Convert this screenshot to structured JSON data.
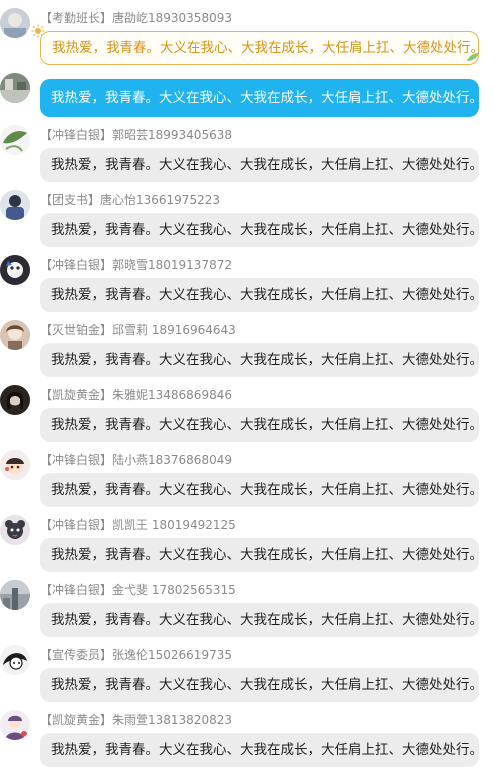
{
  "chat": {
    "messages": [
      {
        "sender": "【考勤班长】唐劭屹18930358093",
        "text": "我热爱，我青春。大义在我心、大我在成长，大任肩上扛、大德处处行。",
        "style": "gold",
        "avatar_color": "#c9cfd8"
      },
      {
        "sender": "",
        "text": "我热爱，我青春。大义在我心、大我在成长，大任肩上扛、大德处处行。",
        "style": "blue",
        "avatar_color": "#7d8a7c"
      },
      {
        "sender": "【冲锋白银】郭昭芸18993405638",
        "text": "我热爱，我青春。大义在我心、大我在成长，大任肩上扛、大德处处行。",
        "style": "gray",
        "avatar_color": "#5f8a4a"
      },
      {
        "sender": "【团支书】唐心怡13661975223",
        "text": "我热爱，我青春。大义在我心、大我在成长，大任肩上扛、大德处处行。",
        "style": "gray",
        "avatar_color": "#445a8c"
      },
      {
        "sender": "【冲锋白银】郭晓雪18019137872",
        "text": "我热爱，我青春。大义在我心、大我在成长，大任肩上扛、大德处处行。",
        "style": "gray",
        "avatar_color": "#2b2b33"
      },
      {
        "sender": "【灭世铂金】邱雪莉 18916964643",
        "text": "我热爱，我青春。大义在我心、大我在成长，大任肩上扛、大德处处行。",
        "style": "gray",
        "avatar_color": "#d9c4b4"
      },
      {
        "sender": "【凯旋黄金】朱雅妮13486869846",
        "text": "我热爱，我青春。大义在我心、大我在成长，大任肩上扛、大德处处行。",
        "style": "gray",
        "avatar_color": "#2a2320"
      },
      {
        "sender": "【冲锋白银】陆小燕18376868049",
        "text": "我热爱，我青春。大义在我心、大我在成长，大任肩上扛、大德处处行。",
        "style": "gray",
        "avatar_color": "#f3ecec"
      },
      {
        "sender": "【冲锋白银】凯凯王 18019492125",
        "text": "我热爱，我青春。大义在我心、大我在成长，大任肩上扛、大德处处行。",
        "style": "gray",
        "avatar_color": "#e7e2e6"
      },
      {
        "sender": "【冲锋白银】金弋斐  17802565315",
        "text": "我热爱，我青春。大义在我心、大我在成长，大任肩上扛、大德处处行。",
        "style": "gray",
        "avatar_color": "#9aa1a8"
      },
      {
        "sender": "【宣传委员】张逸伦15026619735",
        "text": "我热爱，我青春。大义在我心、大我在成长，大任肩上扛、大德处处行。",
        "style": "gray",
        "avatar_color": "#dcdcdc"
      },
      {
        "sender": "【凯旋黄金】朱雨萱13813820823",
        "text": "我热爱，我青春。大义在我心、大我在成长，大任肩上扛、大德处处行。",
        "style": "gray",
        "avatar_color": "#6a4e7d"
      }
    ]
  },
  "colors": {
    "blue_bubble": "#1fb3f0",
    "gray_bubble": "#ececec",
    "gold_text": "#d99316",
    "sender_text": "#8a8a8a"
  }
}
